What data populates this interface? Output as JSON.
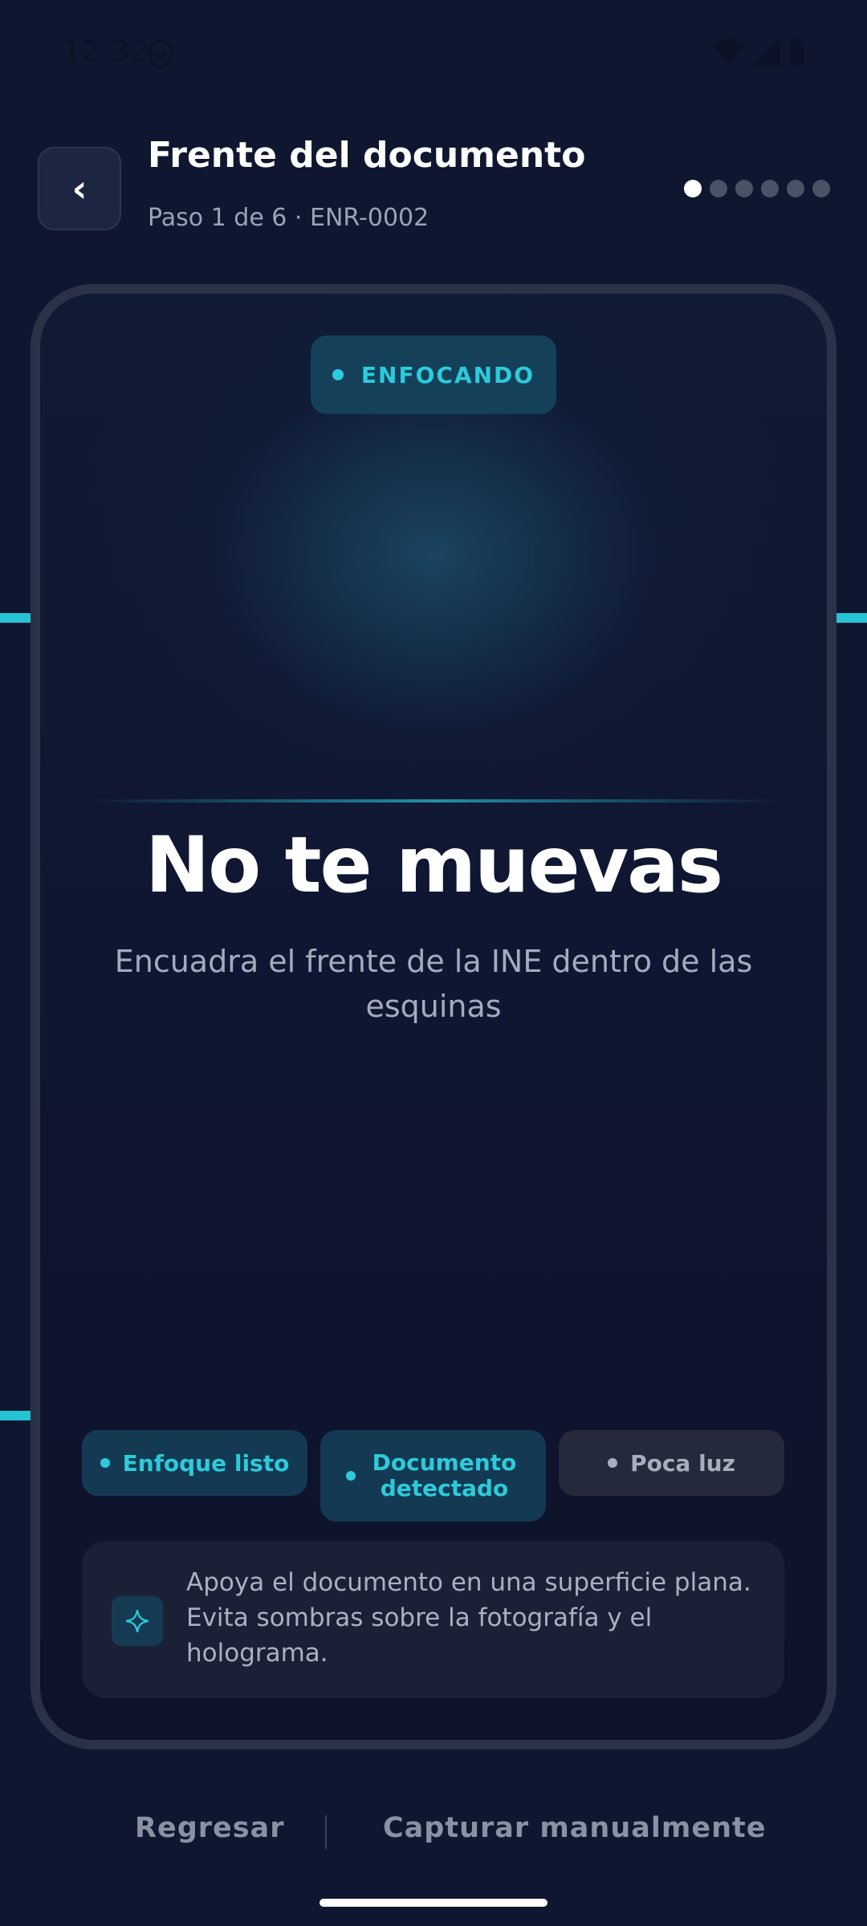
{
  "status_bar": {
    "time": "12:32",
    "icons": [
      "shield-icon",
      "wifi-icon",
      "signal-icon",
      "battery-icon"
    ]
  },
  "header": {
    "back_icon": "‹",
    "title": "Frente del documento",
    "subtitle": "Paso 1 de 6 · ENR-0002",
    "progress": {
      "current_step": 1,
      "total_steps": 6
    }
  },
  "scanner": {
    "badge": "ENFOCANDO",
    "headline": "No te muevas",
    "instruction": "Encuadra el frente de la INE dentro de las esquinas",
    "chips": [
      {
        "label": "Enfoque listo",
        "state": "ok"
      },
      {
        "label": "Documento detectado",
        "state": "ok"
      },
      {
        "label": "Poca luz",
        "state": "warn"
      }
    ],
    "tip": {
      "icon": "sparkle-icon",
      "text": "Apoya el documento en una superficie plana. Evita sombras sobre la fotografía y el holograma."
    }
  },
  "actions": {
    "back_label": "Regresar",
    "manual_label": "Capturar manualmente"
  },
  "colors": {
    "background": "#0f1730",
    "accent": "#26c3d4",
    "badge_bg": "#15405a",
    "warn_chip_bg": "#242a3c"
  }
}
